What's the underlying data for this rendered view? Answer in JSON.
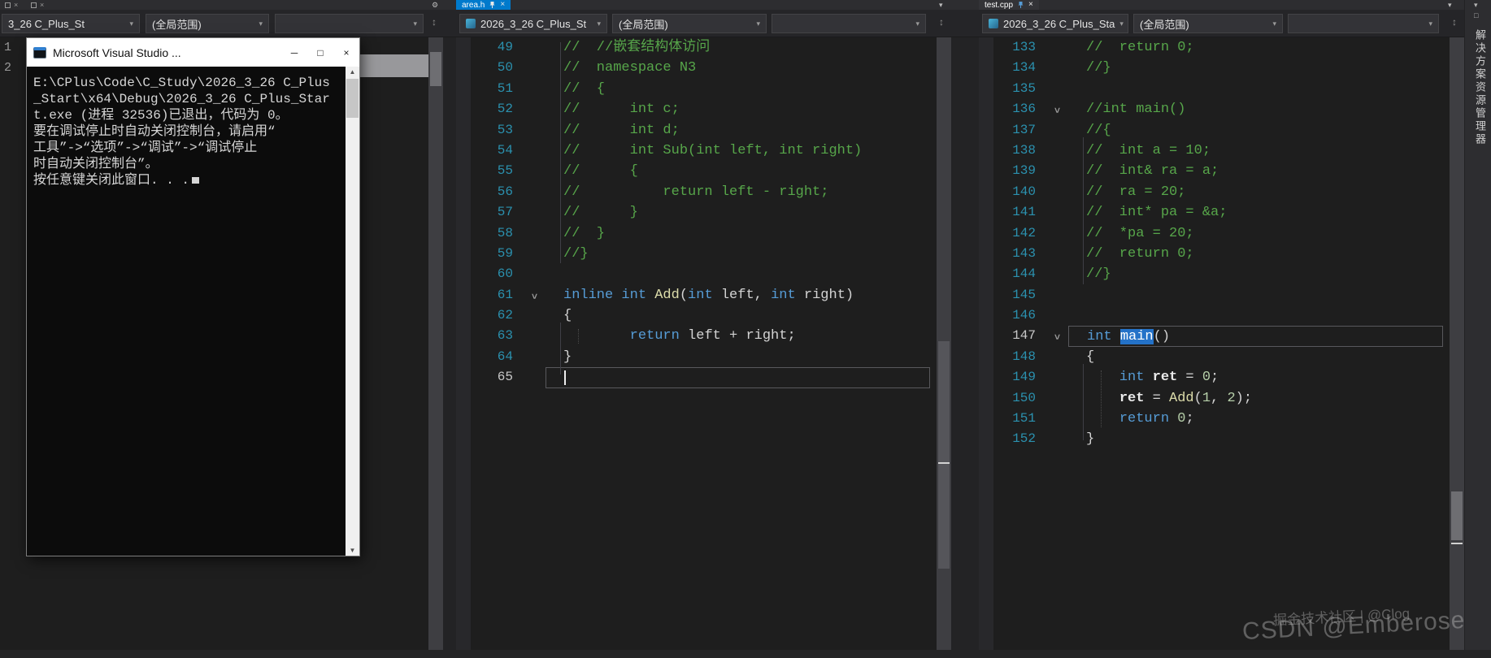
{
  "icons": {
    "dropdown_arrow": "▾",
    "close": "×",
    "gear": "⚙",
    "minimize": "─",
    "maximize": "□",
    "split": "↕",
    "scroll_up": "▲",
    "scroll_down": "▼",
    "fold_chevron": ">"
  },
  "tab_strip": {
    "middle_tab": "area.h",
    "right_tab": "test.cpp"
  },
  "nav": {
    "left": {
      "project": "3_26 C_Plus_St",
      "scope": "(全局范围)"
    },
    "middle": {
      "project": "2026_3_26 C_Plus_St",
      "scope": "(全局范围)"
    },
    "right": {
      "project": "2026_3_26 C_Plus_Sta",
      "scope": "(全局范围)"
    }
  },
  "left_pane": {
    "lines": [
      {
        "n": "1",
        "s": []
      },
      {
        "n": "2",
        "s": []
      }
    ]
  },
  "middle_pane": {
    "lines": [
      {
        "n": "49",
        "s": [
          {
            "c": "comment",
            "t": "//  //嵌套结构体访问"
          }
        ]
      },
      {
        "n": "50",
        "s": [
          {
            "c": "comment",
            "t": "//  namespace N3"
          }
        ]
      },
      {
        "n": "51",
        "s": [
          {
            "c": "comment",
            "t": "//  {"
          }
        ]
      },
      {
        "n": "52",
        "s": [
          {
            "c": "comment",
            "t": "//      int c;"
          }
        ]
      },
      {
        "n": "53",
        "s": [
          {
            "c": "comment",
            "t": "//      int d;"
          }
        ]
      },
      {
        "n": "54",
        "s": [
          {
            "c": "comment",
            "t": "//      int Sub(int left, int right)"
          }
        ]
      },
      {
        "n": "55",
        "s": [
          {
            "c": "comment",
            "t": "//      {"
          }
        ]
      },
      {
        "n": "56",
        "s": [
          {
            "c": "comment",
            "t": "//          return left - right;"
          }
        ]
      },
      {
        "n": "57",
        "s": [
          {
            "c": "comment",
            "t": "//      }"
          }
        ]
      },
      {
        "n": "58",
        "s": [
          {
            "c": "comment",
            "t": "//  }"
          }
        ]
      },
      {
        "n": "59",
        "s": [
          {
            "c": "comment",
            "t": "//}"
          }
        ]
      },
      {
        "n": "60",
        "s": []
      },
      {
        "n": "61",
        "fold": true,
        "s": [
          {
            "c": "kw",
            "t": "inline"
          },
          {
            "c": "plain",
            "t": " "
          },
          {
            "c": "kw",
            "t": "int"
          },
          {
            "c": "plain",
            "t": " "
          },
          {
            "c": "fn",
            "t": "Add"
          },
          {
            "c": "plain",
            "t": "("
          },
          {
            "c": "kw",
            "t": "int"
          },
          {
            "c": "plain",
            "t": " left, "
          },
          {
            "c": "kw",
            "t": "int"
          },
          {
            "c": "plain",
            "t": " right)"
          }
        ]
      },
      {
        "n": "62",
        "s": [
          {
            "c": "plain",
            "t": "{"
          }
        ]
      },
      {
        "n": "63",
        "s": [
          {
            "c": "plain",
            "t": "        "
          },
          {
            "c": "kw",
            "t": "return"
          },
          {
            "c": "plain",
            "t": " left + right;"
          }
        ]
      },
      {
        "n": "64",
        "s": [
          {
            "c": "plain",
            "t": "}"
          }
        ]
      },
      {
        "n": "65",
        "cur": true,
        "caret": true,
        "s": []
      }
    ]
  },
  "right_pane": {
    "lines": [
      {
        "n": "133",
        "s": [
          {
            "c": "comment",
            "t": "//  return 0;"
          }
        ]
      },
      {
        "n": "134",
        "s": [
          {
            "c": "comment",
            "t": "//}"
          }
        ]
      },
      {
        "n": "135",
        "s": []
      },
      {
        "n": "136",
        "fold": true,
        "s": [
          {
            "c": "comment",
            "t": "//int main()"
          }
        ]
      },
      {
        "n": "137",
        "s": [
          {
            "c": "comment",
            "t": "//{"
          }
        ]
      },
      {
        "n": "138",
        "s": [
          {
            "c": "comment",
            "t": "//  int a = 10;"
          }
        ]
      },
      {
        "n": "139",
        "s": [
          {
            "c": "comment",
            "t": "//  int& ra = a;"
          }
        ]
      },
      {
        "n": "140",
        "s": [
          {
            "c": "comment",
            "t": "//  ra = 20;"
          }
        ]
      },
      {
        "n": "141",
        "s": [
          {
            "c": "comment",
            "t": "//  int* pa = &a;"
          }
        ]
      },
      {
        "n": "142",
        "s": [
          {
            "c": "comment",
            "t": "//  *pa = 20;"
          }
        ]
      },
      {
        "n": "143",
        "s": [
          {
            "c": "comment",
            "t": "//  return 0;"
          }
        ]
      },
      {
        "n": "144",
        "s": [
          {
            "c": "comment",
            "t": "//}"
          }
        ]
      },
      {
        "n": "145",
        "s": []
      },
      {
        "n": "146",
        "s": []
      },
      {
        "n": "147",
        "cur": true,
        "fold": true,
        "s": [
          {
            "c": "kw",
            "t": "int"
          },
          {
            "c": "plain",
            "t": " "
          },
          {
            "c": "sel",
            "t": "main"
          },
          {
            "c": "plain",
            "t": "()"
          }
        ]
      },
      {
        "n": "148",
        "s": [
          {
            "c": "plain",
            "t": "{"
          }
        ]
      },
      {
        "n": "149",
        "s": [
          {
            "c": "plain",
            "t": "    "
          },
          {
            "c": "kw",
            "t": "int"
          },
          {
            "c": "plain",
            "t": " "
          },
          {
            "c": "bold",
            "t": "ret"
          },
          {
            "c": "plain",
            "t": " = "
          },
          {
            "c": "num",
            "t": "0"
          },
          {
            "c": "plain",
            "t": ";"
          }
        ]
      },
      {
        "n": "150",
        "s": [
          {
            "c": "plain",
            "t": "    "
          },
          {
            "c": "bold",
            "t": "ret"
          },
          {
            "c": "plain",
            "t": " = "
          },
          {
            "c": "fn",
            "t": "Add"
          },
          {
            "c": "plain",
            "t": "("
          },
          {
            "c": "num",
            "t": "1"
          },
          {
            "c": "plain",
            "t": ", "
          },
          {
            "c": "num",
            "t": "2"
          },
          {
            "c": "plain",
            "t": ");"
          }
        ]
      },
      {
        "n": "151",
        "s": [
          {
            "c": "plain",
            "t": "    "
          },
          {
            "c": "kw",
            "t": "return"
          },
          {
            "c": "plain",
            "t": " "
          },
          {
            "c": "num",
            "t": "0"
          },
          {
            "c": "plain",
            "t": ";"
          }
        ]
      },
      {
        "n": "152",
        "s": [
          {
            "c": "plain",
            "t": "}"
          }
        ]
      }
    ]
  },
  "console": {
    "title": "Microsoft Visual Studio ...",
    "lines": [
      "E:\\CPlus\\Code\\C_Study\\2026_3_26 C_Plus",
      "_Start\\x64\\Debug\\2026_3_26 C_Plus_Star",
      "t.exe (进程 32536)已退出，代码为 0。",
      "要在调试停止时自动关闭控制台，请启用“",
      "工具”->“选项”->“调试”->“调试停止",
      "时自动关闭控制台”。",
      "按任意键关闭此窗口. . ."
    ]
  },
  "side_strip": {
    "label": "解决方案资源管理器"
  },
  "watermarks": {
    "juejin": "掘金技术社区 | @Clog",
    "csdn": "CSDN @Emberose"
  }
}
